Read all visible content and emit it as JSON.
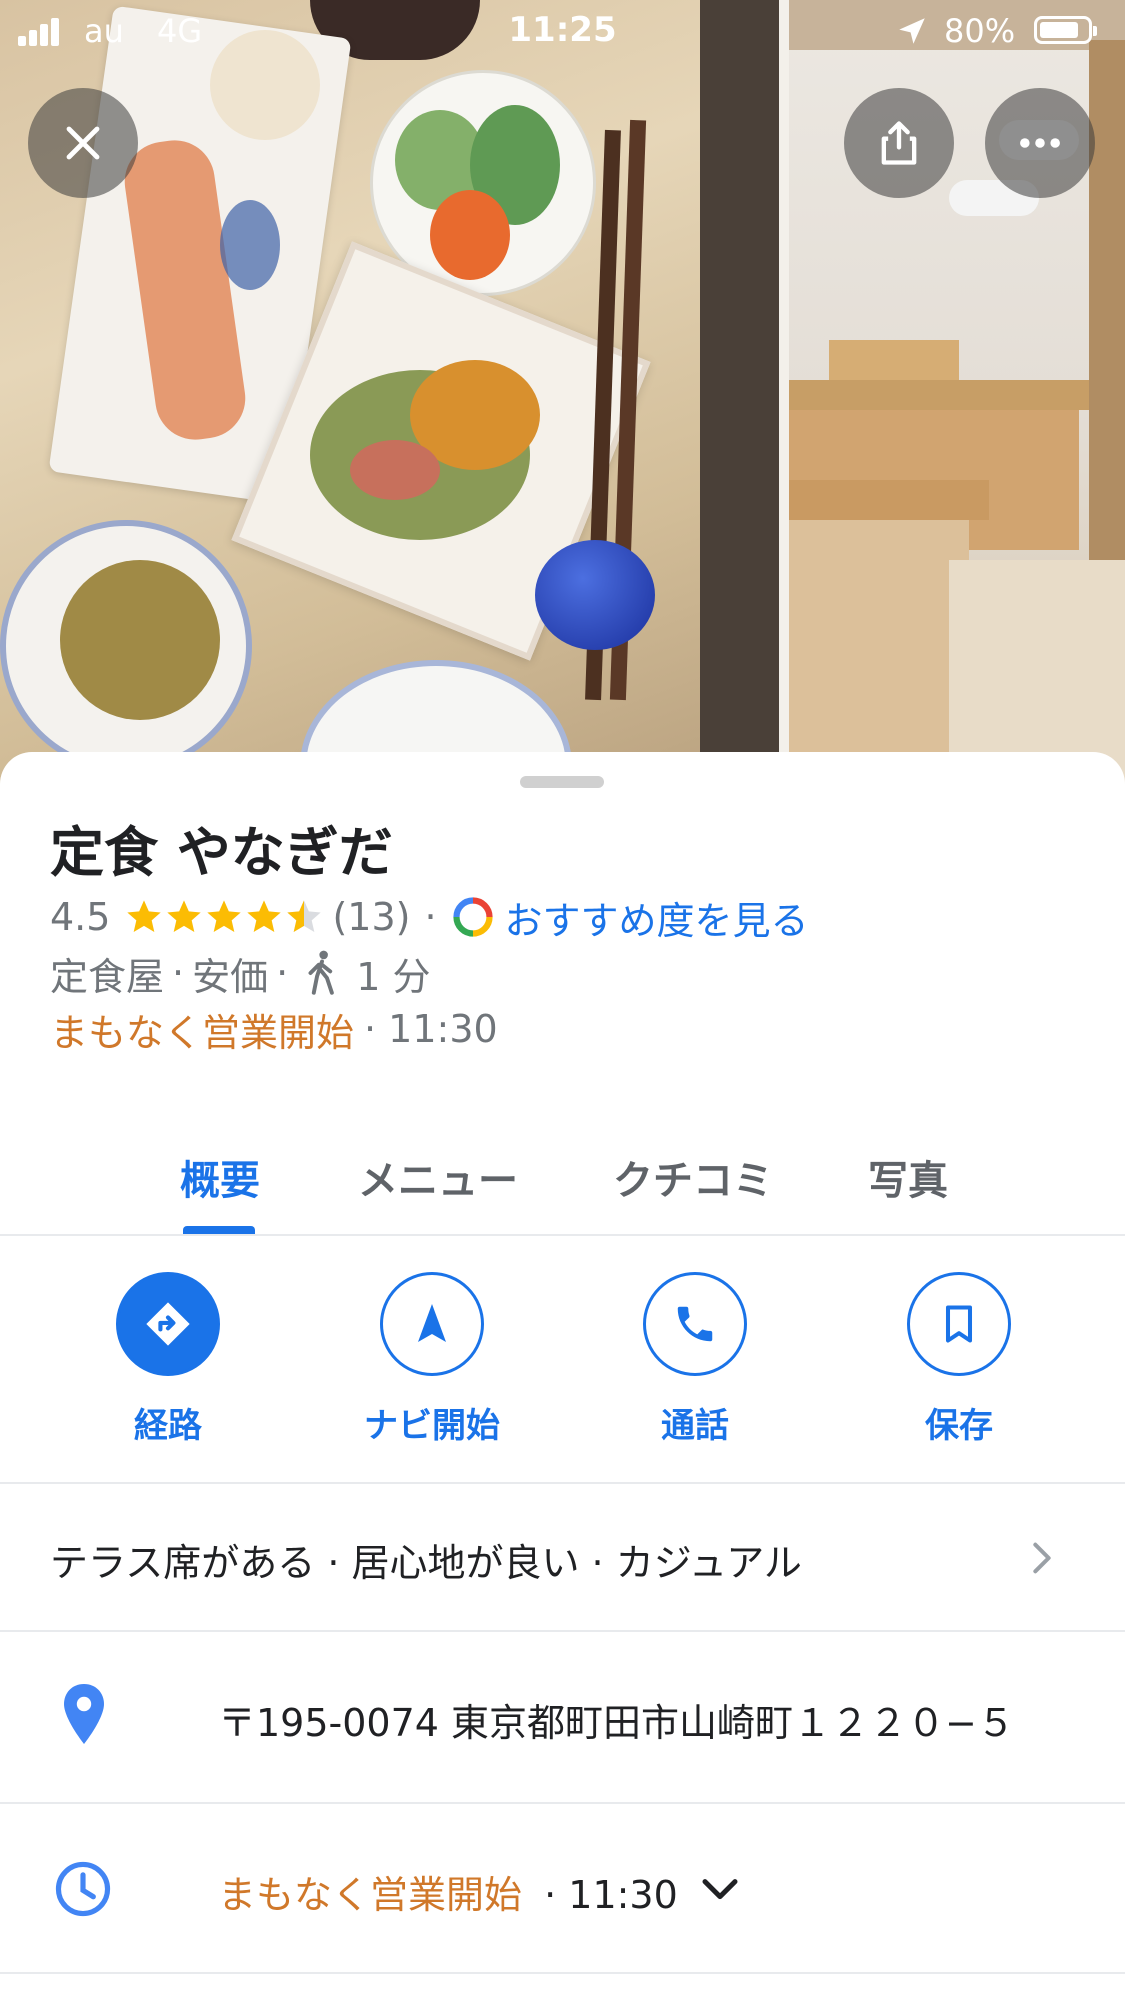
{
  "status_bar": {
    "carrier": "au",
    "network": "4G",
    "time": "11:25",
    "battery": "80%"
  },
  "overlay": {
    "close_icon": "close-icon",
    "share_icon": "share-icon",
    "more_icon": "more-icon"
  },
  "place": {
    "name": "定食 やなぎだ",
    "rating": "4.5",
    "rating_value": 4.5,
    "review_count": "(13)",
    "separator": "·",
    "recommend_link": "おすすめ度を見る",
    "category": "定食屋",
    "price": "安価",
    "walk_time": "1 分",
    "status": "まもなく営業開始",
    "open_time": "· 11:30"
  },
  "tabs": [
    {
      "label": "概要",
      "active": true
    },
    {
      "label": "メニュー",
      "active": false
    },
    {
      "label": "クチコミ",
      "active": false
    },
    {
      "label": "写真",
      "active": false
    }
  ],
  "actions": [
    {
      "label": "経路",
      "icon": "directions-icon"
    },
    {
      "label": "ナビ開始",
      "icon": "navigation-icon"
    },
    {
      "label": "通話",
      "icon": "phone-icon"
    },
    {
      "label": "保存",
      "icon": "bookmark-icon"
    }
  ],
  "details": {
    "attributes": "テラス席がある · 居心地が良い · カジュアル",
    "address": "〒195-0074 東京都町田市山崎町１２２０−５",
    "hours_status": "まもなく営業開始",
    "hours_time": "· 11:30"
  },
  "colors": {
    "accent": "#1a73e8",
    "status_orange": "#d0782a",
    "star": "#fbbc04"
  }
}
